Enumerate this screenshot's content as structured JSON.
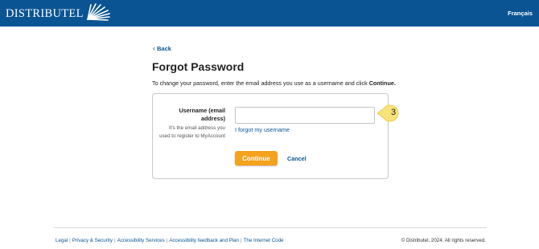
{
  "header": {
    "logo_text": "DISTRIBUTEL",
    "language_link": "Français",
    "brand_color": "#0a5493"
  },
  "back_link": "Back",
  "page_title": "Forgot Password",
  "intro": {
    "text_before": "To change your password, enter the email address you use as a username and click ",
    "bold": "Continue."
  },
  "form": {
    "username_label": "Username (email address)",
    "username_help": "It's the email address you used to register to MyAccount",
    "username_value": "",
    "forgot_username_link": "I forgot my username",
    "continue_button": "Continue",
    "cancel_link": "Cancel"
  },
  "step_badge": "3",
  "footer": {
    "links": [
      "Legal",
      "Privacy & Security",
      "Accessibility Services",
      "Accessibility feedback and Plan",
      "The Internet Code"
    ],
    "copyright": "© Distributel, 2024. All rights reserved."
  },
  "colors": {
    "accent": "#f5a21c",
    "link": "#0a5493",
    "badge": "#f8e27a"
  }
}
